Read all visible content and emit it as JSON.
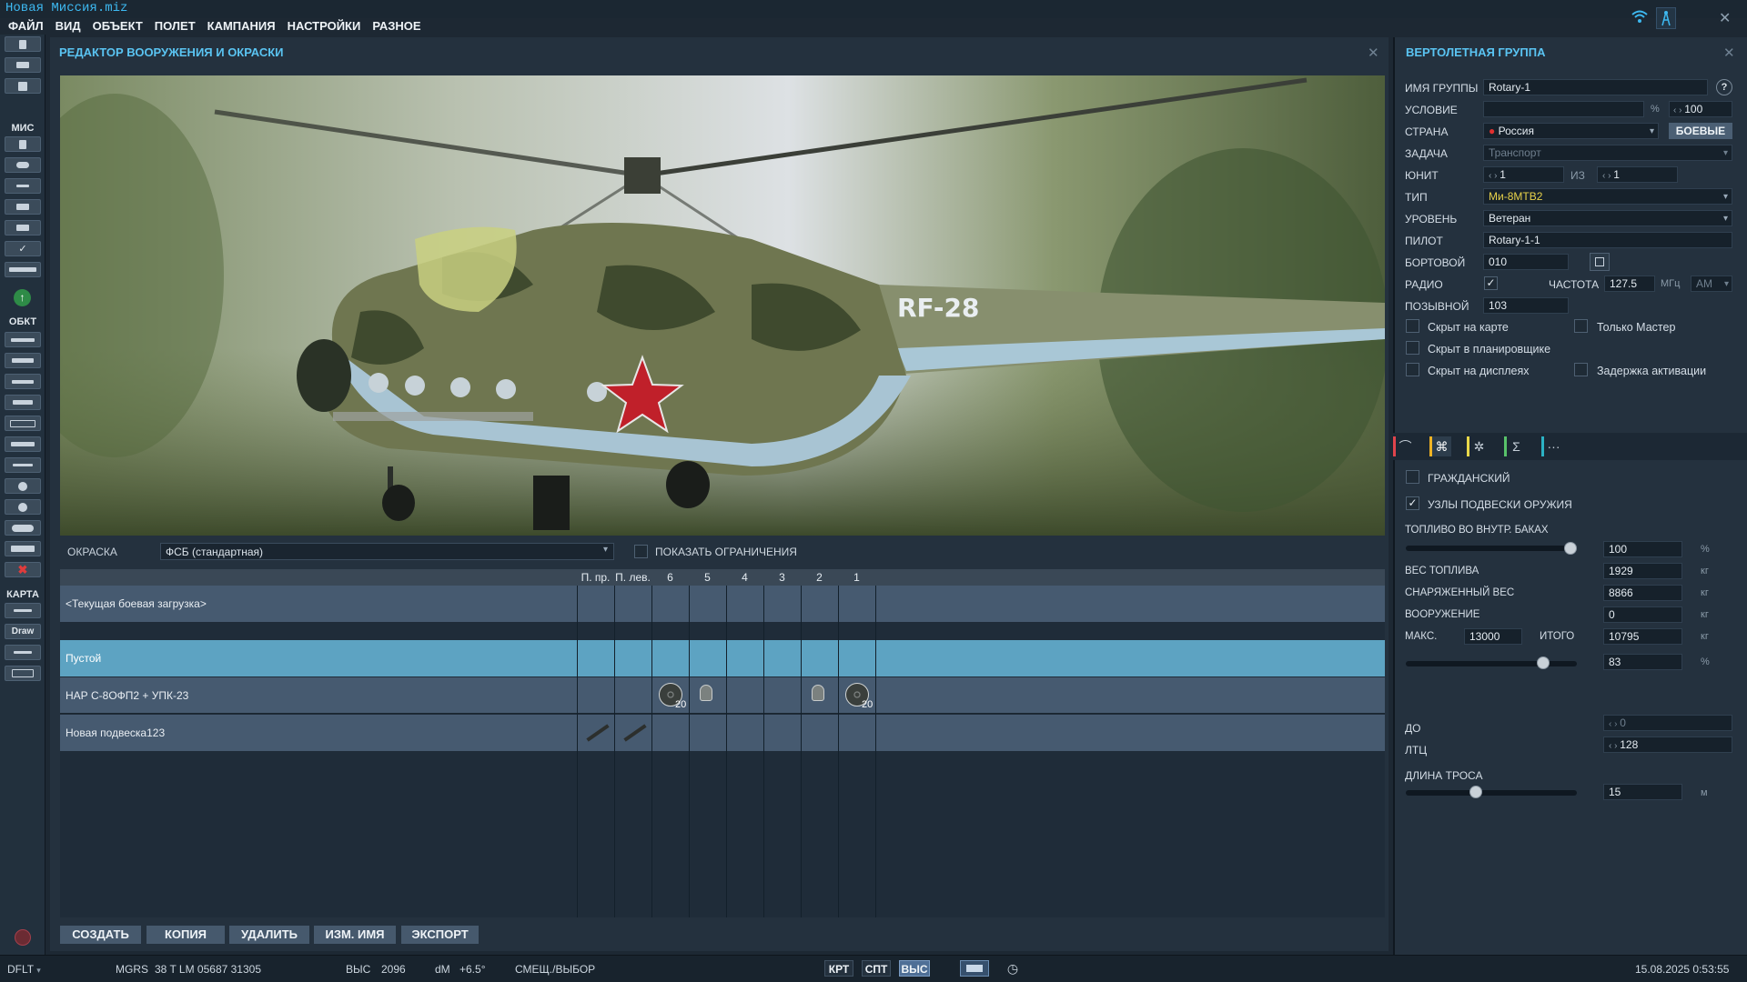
{
  "window": {
    "title": "Новая Миссия.miz"
  },
  "menu": [
    "ФАЙЛ",
    "ВИД",
    "ОБЪЕКТ",
    "ПОЛЕТ",
    "КАМПАНИЯ",
    "НАСТРОЙКИ",
    "РАЗНОЕ"
  ],
  "toolbar": {
    "mis_label": "МИС",
    "obj_label": "ОБКТ",
    "map_label": "КАРТА",
    "draw_label": "Draw"
  },
  "editor": {
    "title": "РЕДАКТОР ВООРУЖЕНИЯ И ОКРАСКИ",
    "aircraft_tail": "RF-28",
    "paint_label": "ОКРАСКА",
    "paint_value": "ФСБ (стандартная)",
    "show_limits_label": "ПОКАЗАТЬ ОГРАНИЧЕНИЯ",
    "columns": [
      "П. пр.",
      "П. лев.",
      "6",
      "5",
      "4",
      "3",
      "2",
      "1"
    ],
    "current_loadout": "<Текущая боевая загрузка>",
    "rows": [
      {
        "label": "Пустой"
      },
      {
        "label": "НАР С-8ОФП2 + УПК-23",
        "counts": [
          "20",
          "20"
        ]
      },
      {
        "label": "Новая подвеска123"
      }
    ],
    "buttons": {
      "create": "СОЗДАТЬ",
      "copy": "КОПИЯ",
      "delete": "УДАЛИТЬ",
      "rename": "ИЗМ. ИМЯ",
      "export": "ЭКСПОРТ"
    }
  },
  "group": {
    "title": "ВЕРТОЛЕТНАЯ ГРУППА",
    "help": "?",
    "name_label": "ИМЯ ГРУППЫ",
    "name_value": "Rotary-1",
    "condition_label": "УСЛОВИЕ",
    "condition_value": "",
    "condition_pct": "%",
    "condition_num": "100",
    "country_label": "СТРАНА",
    "country_value": "Россия",
    "combat_btn": "БОЕВЫЕ",
    "task_label": "ЗАДАЧА",
    "task_value": "Транспорт",
    "unit_label": "ЮНИТ",
    "unit_value": "1",
    "unit_of": "ИЗ",
    "unit_total": "1",
    "type_label": "ТИП",
    "type_value": "Ми-8МТВ2",
    "skill_label": "УРОВЕНЬ",
    "skill_value": "Ветеран",
    "pilot_label": "ПИЛОТ",
    "pilot_value": "Rotary-1-1",
    "board_label": "БОРТОВОЙ",
    "board_value": "010",
    "radio_label": "РАДИО",
    "freq_label": "ЧАСТОТА",
    "freq_value": "127.5",
    "freq_unit": "МГц",
    "modulation": "AM",
    "callsign_label": "ПОЗЫВНОЙ",
    "callsign_value": "103",
    "hidden_map": "Скрыт на карте",
    "master_only": "Только Мастер",
    "hidden_planner": "Скрыт в планировщике",
    "hidden_displays": "Скрыт на дисплеях",
    "late_activation": "Задержка активации",
    "civil_label": "ГРАЖДАНСКИЙ",
    "pylons_label": "УЗЛЫ ПОДВЕСКИ ОРУЖИЯ",
    "fuel_label": "ТОПЛИВО ВО ВНУТР. БАКАХ",
    "fuel_value": "100",
    "fuel_unit": "%",
    "fuel_fraction": 1.0,
    "fuel_weight_label": "ВЕС ТОПЛИВА",
    "fuel_weight": "1929",
    "empty_weight_label": "СНАРЯЖЕННЫЙ ВЕС",
    "empty_weight": "8866",
    "weapons_label": "ВООРУЖЕНИЕ",
    "weapons_weight": "0",
    "max_label": "МАКС.",
    "max_value": "13000",
    "total_label": "ИТОГО",
    "total_value": "10795",
    "kg": "кг",
    "load_pct": "83",
    "load_fraction": 0.83,
    "do_label": "ДО",
    "do_value": "0",
    "ltc_label": "ЛТЦ",
    "ltc_value": "128",
    "rope_label": "ДЛИНА ТРОСА",
    "rope_value": "15",
    "rope_unit": "м",
    "rope_fraction": 0.4
  },
  "status": {
    "profile": "DFLT",
    "coord_label": "MGRS",
    "coord_value": "38 T LM 05687 31305",
    "alt_label": "ВЫС",
    "alt_value": "2096",
    "dm_label": "dM",
    "dm_value": "+6.5°",
    "mode_label": "СМЕЩ./ВЫБОР",
    "btn1": "КРТ",
    "btn2": "СПТ",
    "btn3": "ВЫС",
    "datetime": "15.08.2025 0:53:55"
  },
  "colors": {
    "accent": "#5ac4f2",
    "row_selected": "#5da3c2",
    "row_normal": "#465a70",
    "panel": "#24313e"
  }
}
